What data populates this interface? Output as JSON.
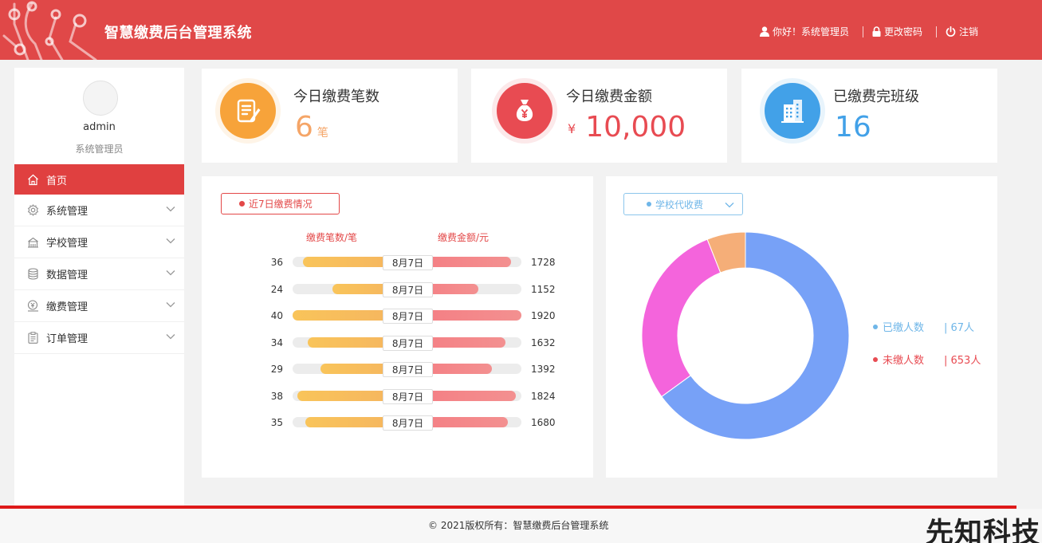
{
  "app": {
    "title": "智慧缴费后台管理系统"
  },
  "header": {
    "greeting": "你好！系统管理员",
    "change_password": "更改密码",
    "logout": "注销",
    "bg_color": "#e04848"
  },
  "user": {
    "name": "admin",
    "role": "系统管理员"
  },
  "sidebar": {
    "items": [
      {
        "label": "首页",
        "icon": "home-icon",
        "active": true
      },
      {
        "label": "系统管理",
        "icon": "gear-icon"
      },
      {
        "label": "学校管理",
        "icon": "school-icon"
      },
      {
        "label": "数据管理",
        "icon": "database-icon"
      },
      {
        "label": "缴费管理",
        "icon": "payment-icon"
      },
      {
        "label": "订单管理",
        "icon": "clipboard-icon"
      }
    ]
  },
  "stats": [
    {
      "label": "今日缴费笔数",
      "value": "6",
      "unit": "笔",
      "color": "#f7a33a",
      "icon": "edit-note-icon"
    },
    {
      "label": "今日缴费金额",
      "value": "10,000",
      "currency": "¥",
      "color": "#e84b52",
      "icon": "money-bag-icon"
    },
    {
      "label": "已缴费完班级",
      "value": "16",
      "color": "#42a1e8",
      "icon": "building-icon"
    }
  ],
  "payments_panel": {
    "filter_label": "近7日缴费情况",
    "left_header": "缴费笔数/笔",
    "right_header": "缴费金额/元",
    "rows": [
      {
        "count": 36,
        "date": "8月7日",
        "amount": 1728
      },
      {
        "count": 24,
        "date": "8月7日",
        "amount": 1152
      },
      {
        "count": 40,
        "date": "8月7日",
        "amount": 1920
      },
      {
        "count": 34,
        "date": "8月7日",
        "amount": 1632
      },
      {
        "count": 29,
        "date": "8月7日",
        "amount": 1392
      },
      {
        "count": 38,
        "date": "8月7日",
        "amount": 1824
      },
      {
        "count": 35,
        "date": "8月7日",
        "amount": 1680
      }
    ]
  },
  "donut_panel": {
    "select_label": "学校代收费",
    "legend": [
      {
        "label": "已缴人数",
        "value": "| 67人",
        "color": "#6fb6e8"
      },
      {
        "label": "未缴人数",
        "value": "| 653人",
        "color": "#e84b52"
      }
    ]
  },
  "chart_data": {
    "type": "pie",
    "style": "donut",
    "slices": [
      {
        "share": 0.65,
        "color": "#77a1f7"
      },
      {
        "share": 0.29,
        "color": "#f464dc"
      },
      {
        "share": 0.06,
        "color": "#f5ae78"
      }
    ]
  },
  "footer": {
    "copyright": "© 2021版权所有：智慧缴费后台管理系统"
  },
  "watermark": "先知科技"
}
